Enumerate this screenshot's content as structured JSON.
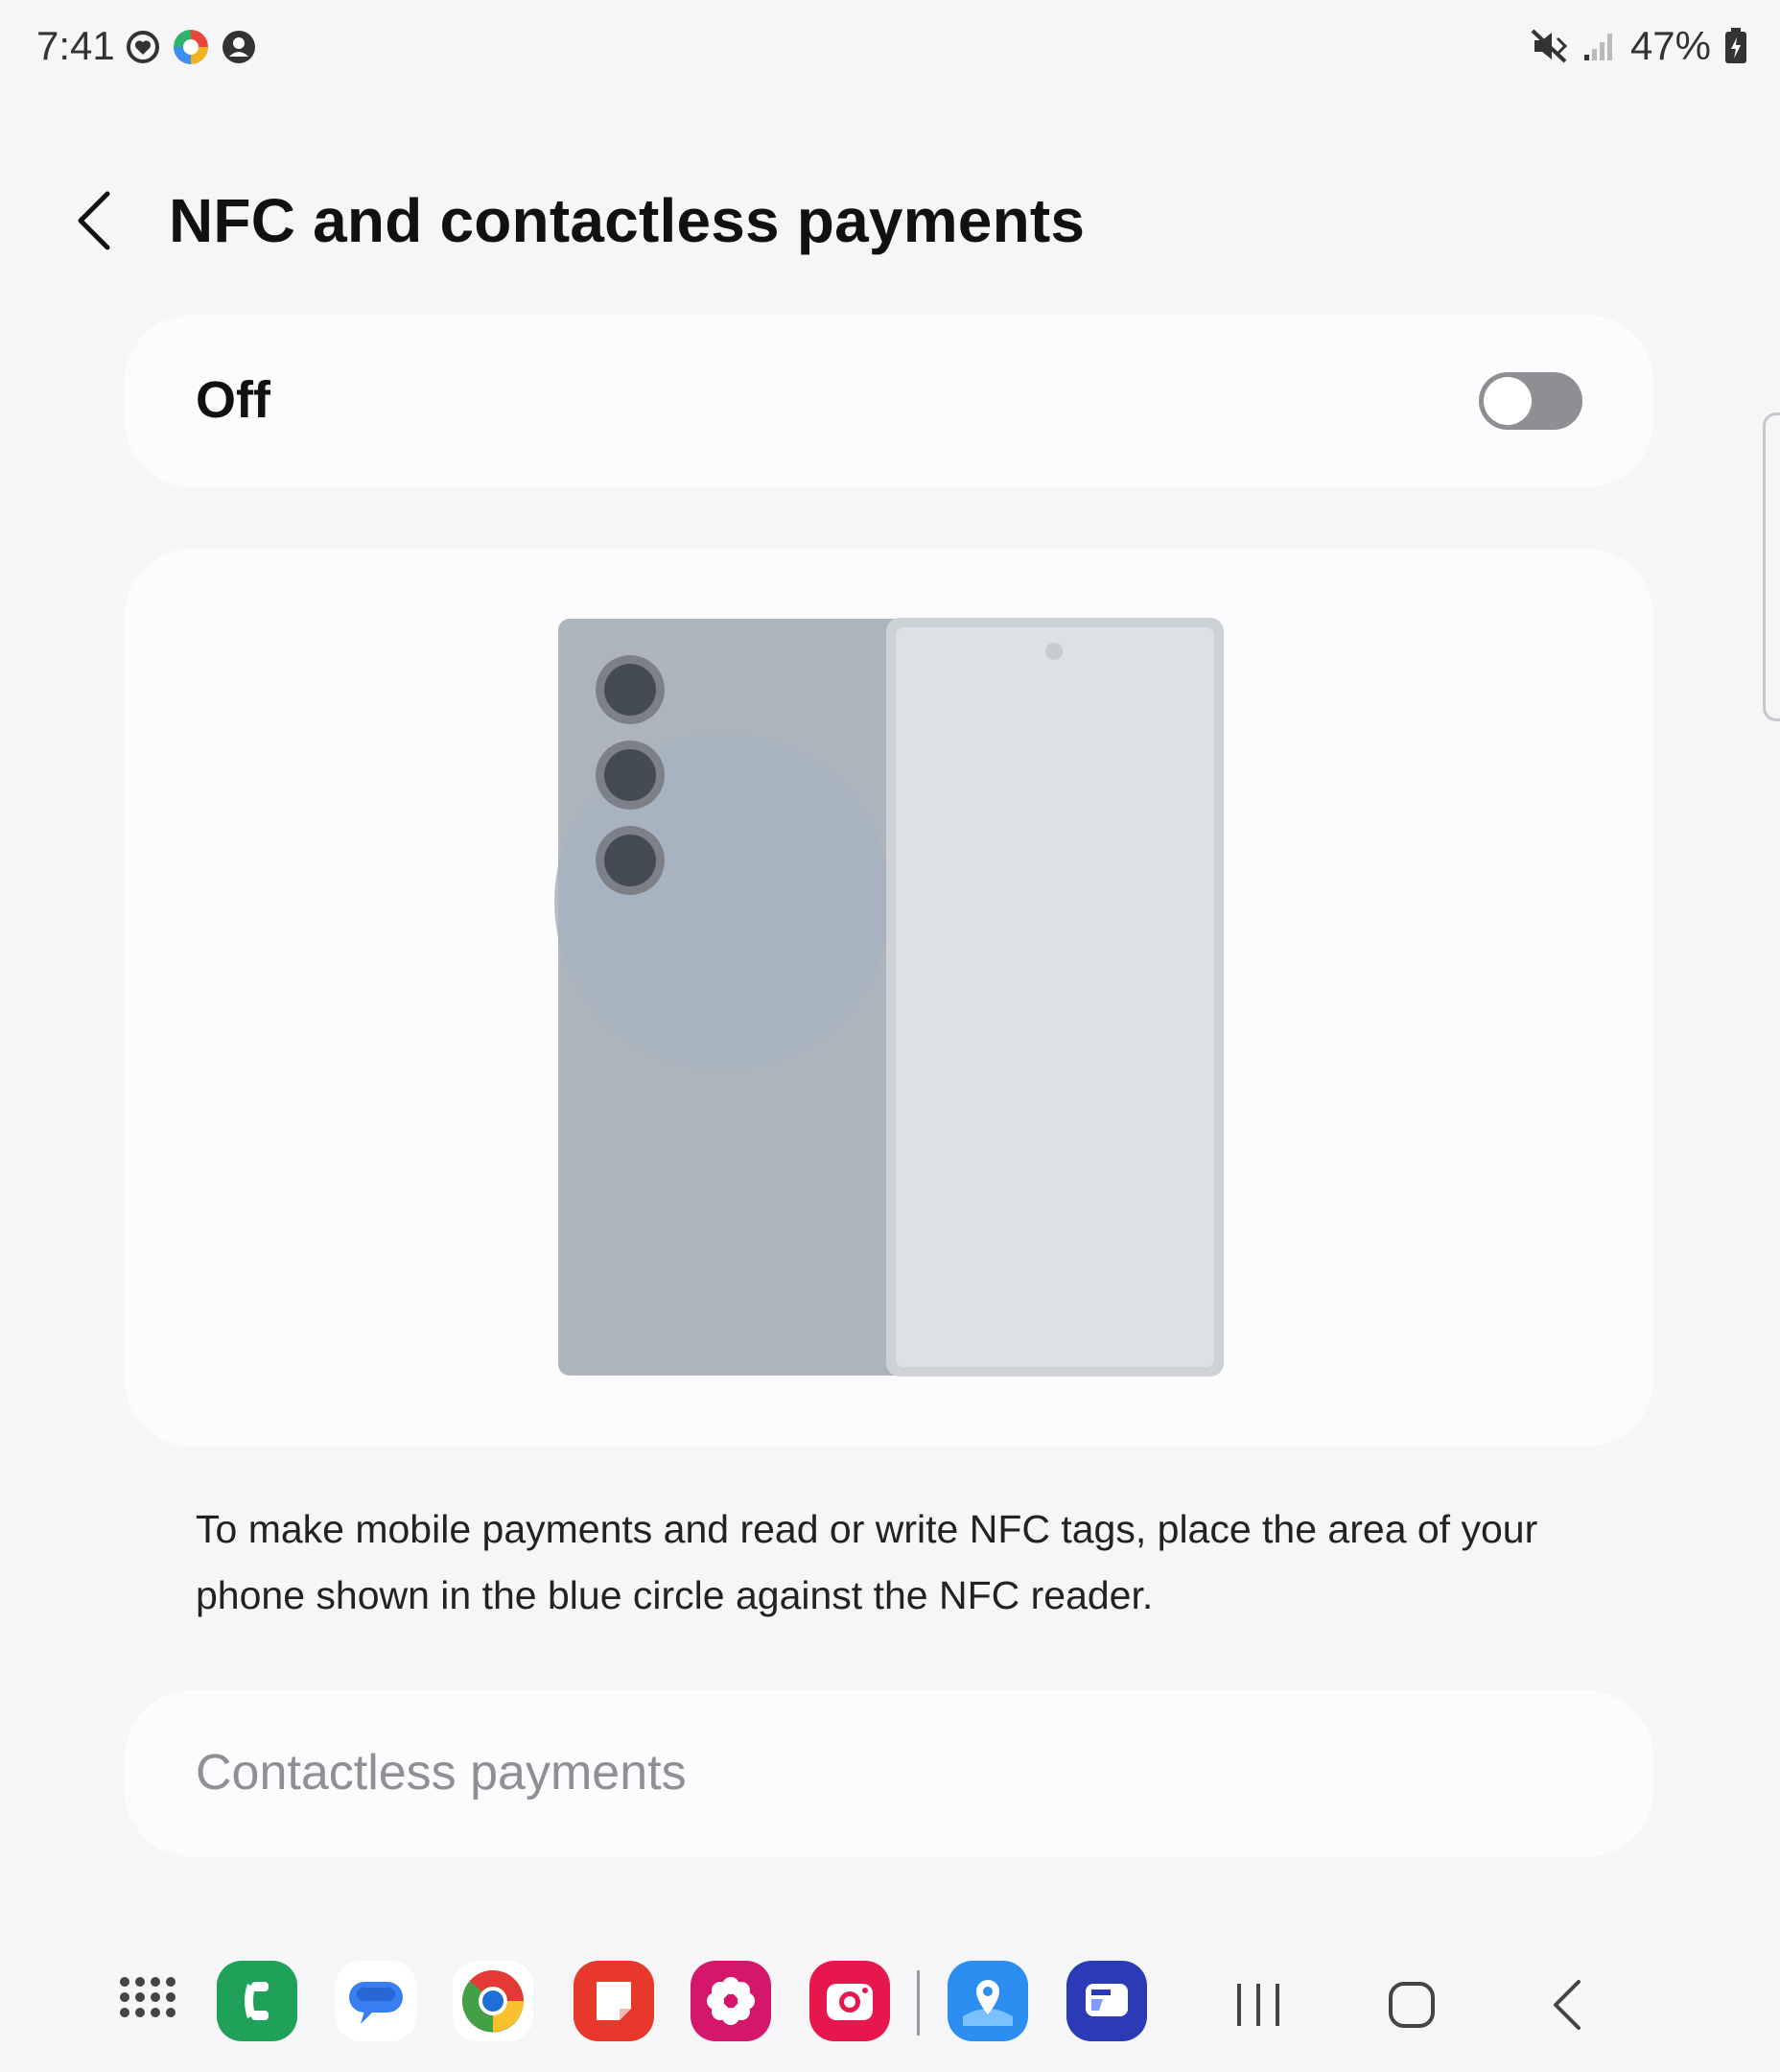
{
  "status_bar": {
    "time": "7:41",
    "battery": "47%",
    "icons": [
      "heart-face-icon",
      "colorful-app-icon",
      "account-icon",
      "mute-vibrate-icon",
      "signal-icon",
      "battery-charging-icon"
    ]
  },
  "header": {
    "back_icon": "chevron-left-icon",
    "title": "NFC and contactless payments"
  },
  "master_switch": {
    "label": "Off",
    "state": "off"
  },
  "illustration": {
    "description_icon": "foldable-phone-illustration",
    "nfc_area_color": "#a6b3bf"
  },
  "description": "To make mobile payments and read or write NFC tags, place the area of your phone shown in the blue circle against the NFC reader.",
  "contactless_payments": {
    "label": "Contactless payments",
    "enabled": false
  },
  "taskbar": {
    "apps": [
      {
        "name": "phone-app-icon",
        "color": "#1fa15a"
      },
      {
        "name": "messages-app-icon",
        "color": "#ffffff"
      },
      {
        "name": "chrome-app-icon",
        "color": "#ffffff"
      },
      {
        "name": "notes-app-icon",
        "color": "#e8382c"
      },
      {
        "name": "gallery-app-icon",
        "color": "#d5176b"
      },
      {
        "name": "camera-app-icon",
        "color": "#e5174d"
      },
      {
        "name": "maps-app-icon",
        "color": "#2b8ef0"
      },
      {
        "name": "samsung-internet-app-icon",
        "color": "#2a3bb5"
      }
    ],
    "nav": [
      "recents-button",
      "home-button",
      "back-button"
    ]
  },
  "colors": {
    "background": "#f6f6f8",
    "card": "#fcfcfe",
    "toggle_off": "#8e8e93",
    "disabled_text": "#8f9094"
  }
}
